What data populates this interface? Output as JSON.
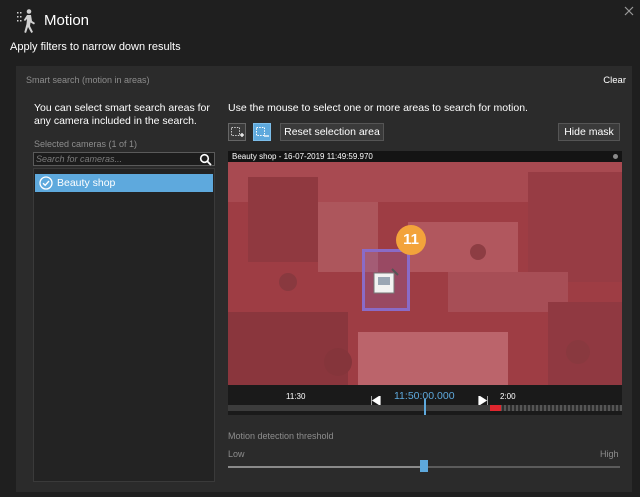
{
  "window": {
    "title": "Motion",
    "subtitle": "Apply filters to narrow down results",
    "icons": {
      "title": "motion-walking-icon",
      "close": "close-icon"
    }
  },
  "panel": {
    "title": "Smart search (motion in areas)",
    "clear_label": "Clear"
  },
  "cameras": {
    "help_text": "You can select smart search areas for any camera included in the search.",
    "selected_count_label": "Selected cameras (1 of 1)",
    "search": {
      "placeholder": "Search for cameras...",
      "value": ""
    },
    "items": [
      {
        "label": "Beauty shop",
        "checked": true
      }
    ]
  },
  "area_tools": {
    "help_text": "Use the mouse to select one or more areas to search for motion.",
    "tools": [
      {
        "name": "add-area-icon",
        "active": false
      },
      {
        "name": "remove-area-icon",
        "active": true
      }
    ],
    "reset_label": "Reset selection area",
    "hide_mask_label": "Hide mask"
  },
  "video": {
    "caption": "Beauty shop - 16-07-2019 11:49:59.970",
    "callout_number": "11"
  },
  "timeline": {
    "left_label": "11:30",
    "current_time": "11:50:00.000",
    "right_label": "2:00",
    "playhead_fraction": 0.5
  },
  "threshold": {
    "title": "Motion detection threshold",
    "low_label": "Low",
    "high_label": "High",
    "value_fraction": 0.5
  },
  "colors": {
    "accent": "#5ea9dd",
    "mask": "#d74650",
    "selection_border": "#8a6bc7",
    "callout": "#f3a33b",
    "marker_red": "#e0262e"
  }
}
